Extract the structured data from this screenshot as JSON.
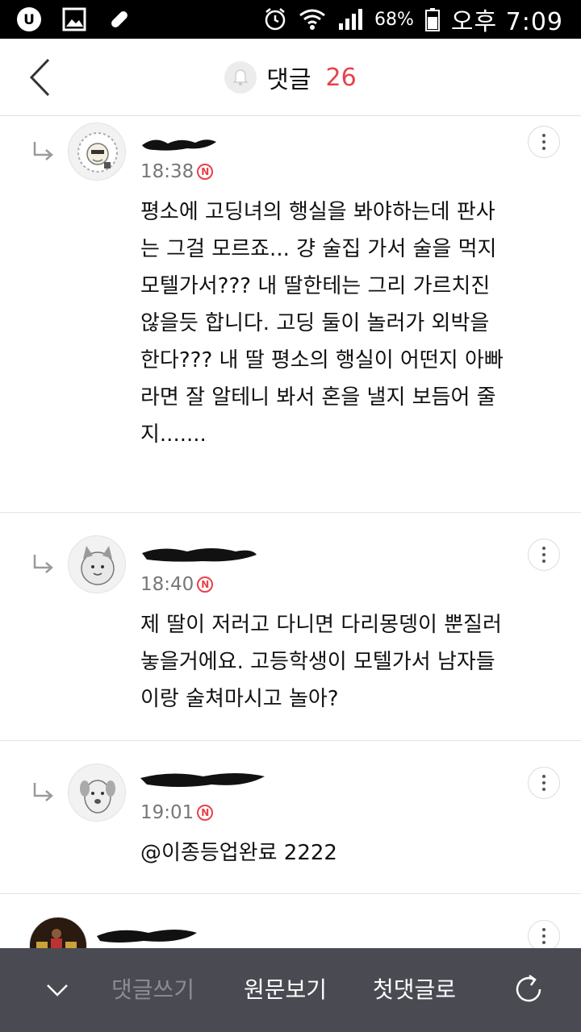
{
  "status_bar": {
    "battery": "68%",
    "ampm": "오후",
    "time": "7:09",
    "icons": [
      "u-plus-icon",
      "image-icon",
      "bandage-icon",
      "alarm-icon",
      "wifi-icon",
      "signal-icon",
      "battery-icon"
    ]
  },
  "header": {
    "title": "댓글",
    "count": "26",
    "count_color": "#e8414b",
    "icons": [
      "back-icon",
      "bell-icon"
    ]
  },
  "comments": [
    {
      "time": "18:38",
      "badge": "N",
      "body": "평소에 고딩녀의 행실을 봐야하는데 판사는 그걸 모르죠... 걍 술집 가서 술을 먹지 모텔가서??? 내 딸한테는 그리 가르치진 않을듯 합니다. 고딩 둘이 놀러가 외박을 한다??? 내 딸 평소의 행실이 어떤지 아빠라면 잘 알테니 봐서 혼을 낼지 보듬어 줄지......."
    },
    {
      "time": "18:40",
      "badge": "N",
      "body": "제 딸이 저러고 다니면 다리몽뎅이 뿐질러놓을거에요. 고등학생이 모텔가서 남자들이랑 술쳐마시고 놀아?"
    },
    {
      "time": "19:01",
      "badge": "N",
      "body": "@이종등업완료 2222"
    },
    {
      "time": "",
      "badge": "",
      "body": ""
    }
  ],
  "toolbar": {
    "write_comment": "댓글쓰기",
    "view_original": "원문보기",
    "first_comment": "첫댓글로",
    "icons": [
      "chevron-down-icon",
      "refresh-icon"
    ]
  }
}
